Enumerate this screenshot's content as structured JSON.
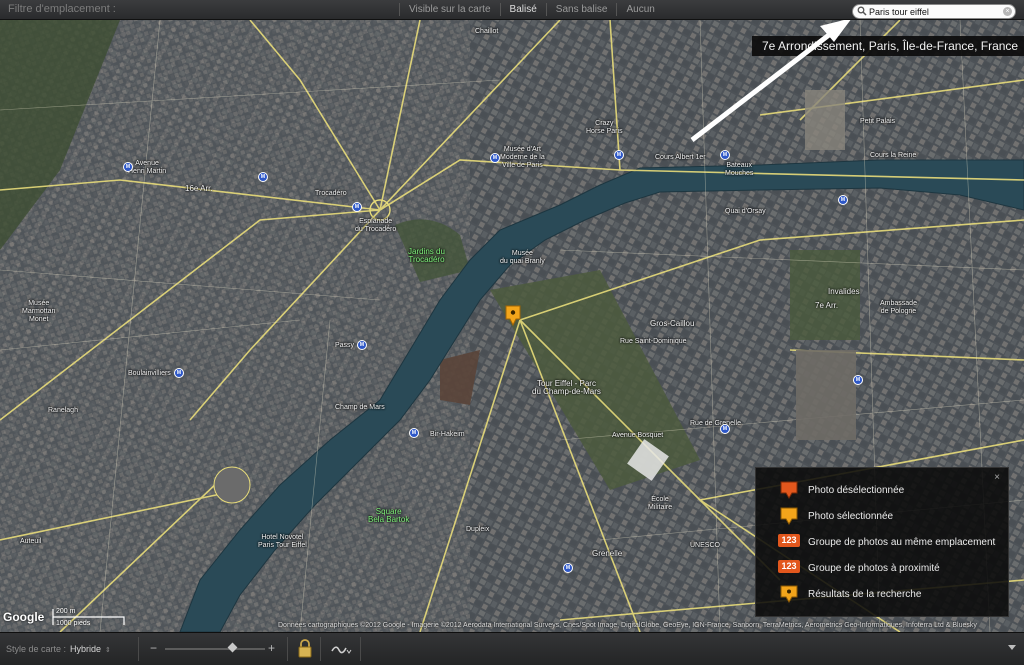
{
  "filter_bar": {
    "label": "Filtre d'emplacement :",
    "options": [
      "Visible sur la carte",
      "Balisé",
      "Sans balise",
      "Aucun"
    ],
    "active_option": "Balisé"
  },
  "search": {
    "value": "Paris tour eiffel",
    "placeholder": "",
    "result": "7e Arrondissement, Paris, Île-de-France, France"
  },
  "map": {
    "labels": [
      {
        "text": "Chaillot"
      },
      {
        "text": "Avenue\nHenri Martin"
      },
      {
        "text": "16e Arr."
      },
      {
        "text": "Trocadéro"
      },
      {
        "text": "Esplanade\ndu Trocadéro"
      },
      {
        "text": "Musée d'Art\nModerne de la\nVille de Paris"
      },
      {
        "text": "Crazy\nHorse Paris"
      },
      {
        "text": "Musée\ndu quai Branly"
      },
      {
        "text": "Tour Eiffel - Parc\ndu Champ-de-Mars"
      },
      {
        "text": "Gros-Caillou"
      },
      {
        "text": "Invalides"
      },
      {
        "text": "7e Arr."
      },
      {
        "text": "Ambassade\nde Pologne"
      },
      {
        "text": "Quai d'Orsay"
      },
      {
        "text": "Cours Albert 1er"
      },
      {
        "text": "Bateaux\nMouches"
      },
      {
        "text": "Cours la Reine"
      },
      {
        "text": "Petit Palais"
      },
      {
        "text": "Musée\nMarmottan\nMonet"
      },
      {
        "text": "Passy"
      },
      {
        "text": "Boulainvilliers"
      },
      {
        "text": "Ranelagh"
      },
      {
        "text": "Bir-Hakeim"
      },
      {
        "text": "Champ de Mars"
      },
      {
        "text": "Hotel Novotel\nParis Tour Eiffel"
      },
      {
        "text": "Dupleix"
      },
      {
        "text": "Grenelle"
      },
      {
        "text": "École\nMilitaire"
      },
      {
        "text": "UNESCO"
      },
      {
        "text": "Auteuil"
      },
      {
        "text": "Rue Saint-Dominique"
      },
      {
        "text": "Avenue Bosquet"
      },
      {
        "text": "Rue de Grenelle"
      }
    ],
    "park_labels": [
      {
        "text": "Jardins du\nTrocadéro"
      },
      {
        "text": "Square\nBela Bartok"
      }
    ],
    "metro_symbol": "M"
  },
  "legend": {
    "close": "×",
    "items": [
      {
        "label": "Photo désélectionnée",
        "kind": "pin-orange"
      },
      {
        "label": "Photo sélectionnée",
        "kind": "pin-yellow"
      },
      {
        "label": "Groupe de photos au même emplacement",
        "kind": "badge",
        "badge": "123"
      },
      {
        "label": "Groupe de photos à proximité",
        "kind": "badge",
        "badge": "123"
      },
      {
        "label": "Résultats de la recherche",
        "kind": "pin-search"
      }
    ]
  },
  "attribution": {
    "logo": "Google",
    "scale_top": "200 m",
    "scale_bottom": "1000 pieds",
    "copyright": "Données cartographiques ©2012 Google - Imagerie ©2012 Aerodata International Surveys, Cnes/Spot Image, DigitalGlobe, GeoEye, IGN-France, Sanborn, TerraMetrics, Aerometrics Geo-Informatiques, Infoterra Ltd & Bluesky"
  },
  "toolbar": {
    "map_style_label": "Style de carte :",
    "map_style_value": "Hybride",
    "zoom_minus": "−",
    "zoom_plus": "+",
    "zoom_level": 0.68
  },
  "colors": {
    "orange_pin": "#e2571d",
    "yellow_pin": "#f3a51b",
    "metro": "#2d57c8",
    "park_text": "#7ef07a",
    "road": "#e8dc7a"
  }
}
